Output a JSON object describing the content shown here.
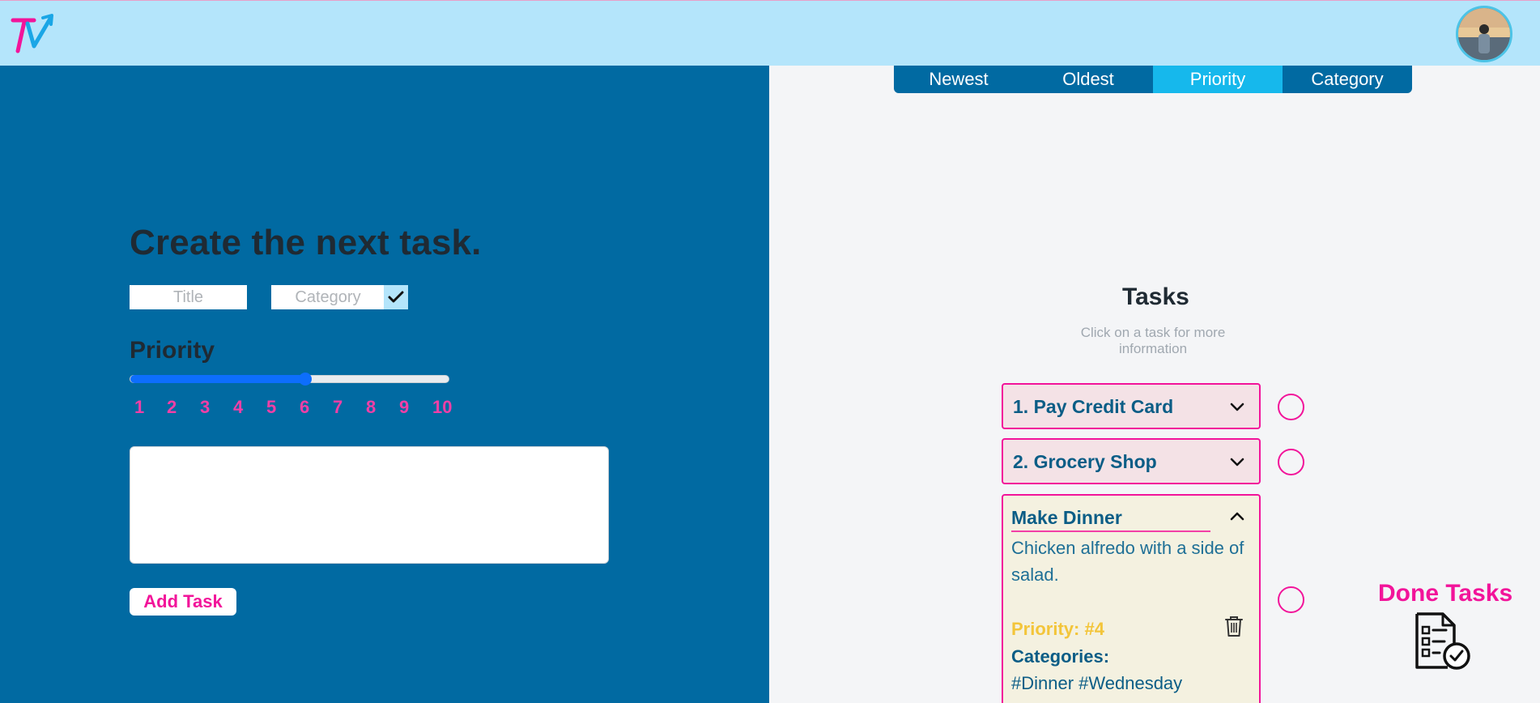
{
  "header": {
    "logo_text": "TV",
    "avatar_alt": "user-avatar"
  },
  "create": {
    "heading": "Create the next task.",
    "title_placeholder": "Title",
    "category_placeholder": "Category",
    "priority_label": "Priority",
    "priority_value": 6,
    "priority_min": 1,
    "priority_max": 10,
    "priority_ticks": [
      "1",
      "2",
      "3",
      "4",
      "5",
      "6",
      "7",
      "8",
      "9",
      "10"
    ],
    "notes_value": "",
    "add_button": "Add Task"
  },
  "sort_tabs": [
    {
      "label": "Newest",
      "active": false
    },
    {
      "label": "Oldest",
      "active": false
    },
    {
      "label": "Priority",
      "active": true
    },
    {
      "label": "Category",
      "active": false
    }
  ],
  "tasks": {
    "title": "Tasks",
    "subtitle": "Click on a task for more information",
    "items": [
      {
        "name": "1. Pay Credit Card",
        "expanded": false
      },
      {
        "name": "2. Grocery Shop",
        "expanded": false
      },
      {
        "name": "Make Dinner",
        "expanded": true,
        "description": "Chicken alfredo with a side of salad.",
        "priority": "Priority: #4",
        "categories_label": "Categories:",
        "categories": "#Dinner #Wednesday"
      }
    ]
  },
  "done": {
    "title": "Done Tasks"
  },
  "colors": {
    "topbar": "#b4e5fb",
    "left_panel": "#016aa2",
    "accent_pink": "#f2149a",
    "accent_blue": "#16b8ec",
    "priority_yellow": "#f3c53a"
  }
}
